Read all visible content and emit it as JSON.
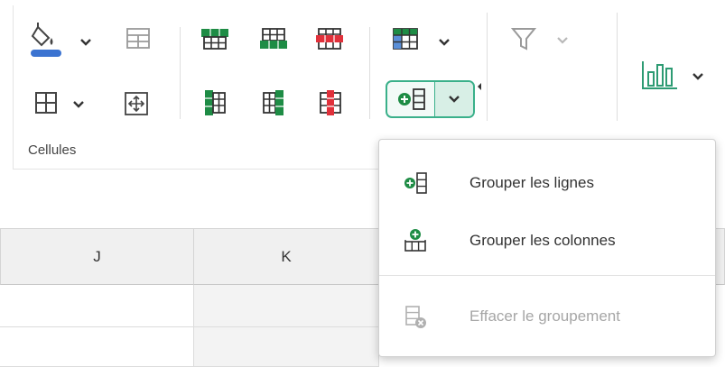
{
  "ribbon": {
    "group_label": "Cellules"
  },
  "columns": [
    "J",
    "K"
  ],
  "menu": {
    "items": [
      {
        "label": "Grouper les lignes",
        "enabled": true,
        "icon": "group-rows-icon"
      },
      {
        "label": "Grouper les colonnes",
        "enabled": true,
        "icon": "group-columns-icon"
      },
      {
        "label": "Effacer le groupement",
        "enabled": false,
        "icon": "clear-grouping-icon"
      }
    ]
  },
  "colors": {
    "accent_green": "#1e8c45",
    "insert_green": "#21a366",
    "delete_red": "#e0313b",
    "fill_blue": "#3b73d1",
    "active_border": "#3ab08a"
  }
}
